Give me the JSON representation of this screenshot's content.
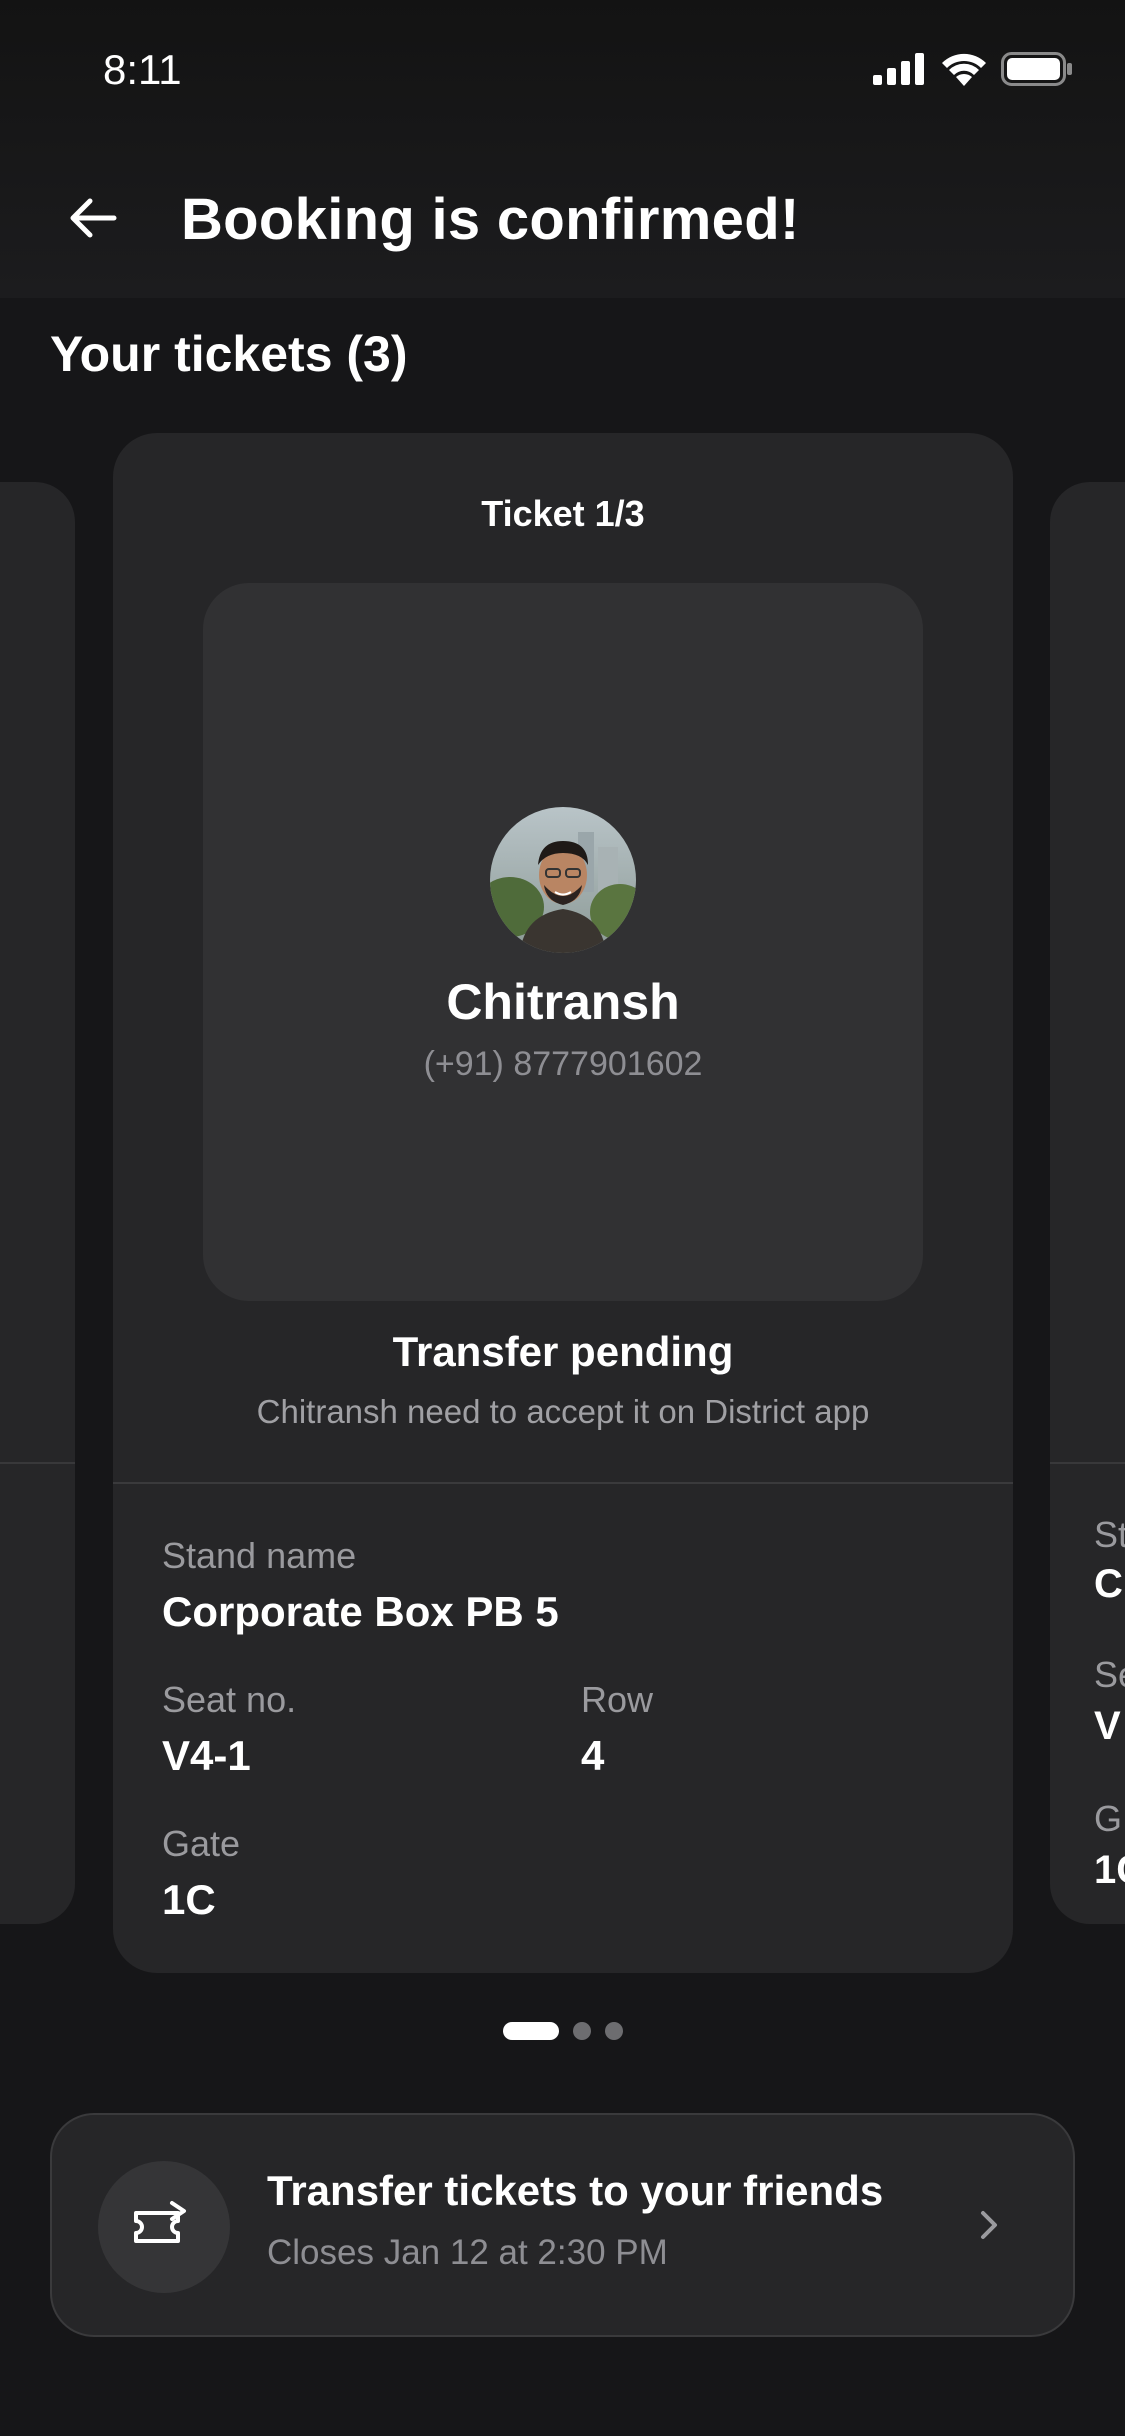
{
  "status_bar": {
    "time": "8:11"
  },
  "header": {
    "title": "Booking is confirmed!"
  },
  "tickets_section": {
    "title": "Your tickets (3)"
  },
  "ticket": {
    "label": "Ticket 1/3",
    "holder_name": "Chitransh",
    "holder_phone": "(+91) 8777901602",
    "transfer_status": "Transfer pending",
    "transfer_note": "Chitransh need to accept it on District app",
    "stand_label": "Stand name",
    "stand_value": "Corporate Box PB 5",
    "seat_label": "Seat no.",
    "seat_value": "V4-1",
    "row_label": "Row",
    "row_value": "4",
    "gate_label": "Gate",
    "gate_value": "1C"
  },
  "next_ticket_peek": {
    "stand_label": "St",
    "stand_value": "C",
    "seat_label": "Se",
    "seat_value": "V",
    "gate_label": "G",
    "gate_value": "1C"
  },
  "pager": {
    "total": 3,
    "active_index": 0
  },
  "transfer_banner": {
    "title": "Transfer tickets to your friends",
    "subtitle": "Closes Jan 12 at 2:30 PM",
    "icon": "ticket-transfer-icon"
  },
  "colors": {
    "background": "#161618",
    "card": "#262628",
    "panel": "#313133",
    "muted_text": "#8e8e93"
  }
}
